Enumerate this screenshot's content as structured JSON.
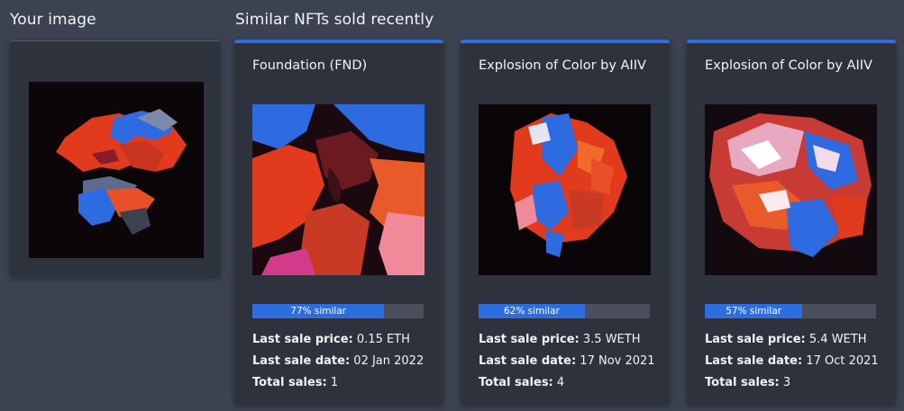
{
  "your_image": {
    "title": "Your image"
  },
  "similar": {
    "title": "Similar NFTs sold recently"
  },
  "labels": {
    "last_sale_price": "Last sale price:",
    "last_sale_date": "Last sale date:",
    "total_sales": "Total sales:"
  },
  "colors": {
    "accent": "#2f6ee0",
    "background": "#3d4250",
    "card": "#2e323d"
  },
  "nfts": [
    {
      "title": "Foundation (FND)",
      "similarity_pct": 77,
      "similarity_label": "77% similar",
      "price": "0.15 ETH",
      "date": "02 Jan 2022",
      "total_sales": "1"
    },
    {
      "title": "Explosion of Color by AIIV",
      "similarity_pct": 62,
      "similarity_label": "62% similar",
      "price": "3.5 WETH",
      "date": "17 Nov 2021",
      "total_sales": "4"
    },
    {
      "title": "Explosion of Color by AIIV",
      "similarity_pct": 57,
      "similarity_label": "57% similar",
      "price": "5.4 WETH",
      "date": "17 Oct 2021",
      "total_sales": "3"
    }
  ]
}
